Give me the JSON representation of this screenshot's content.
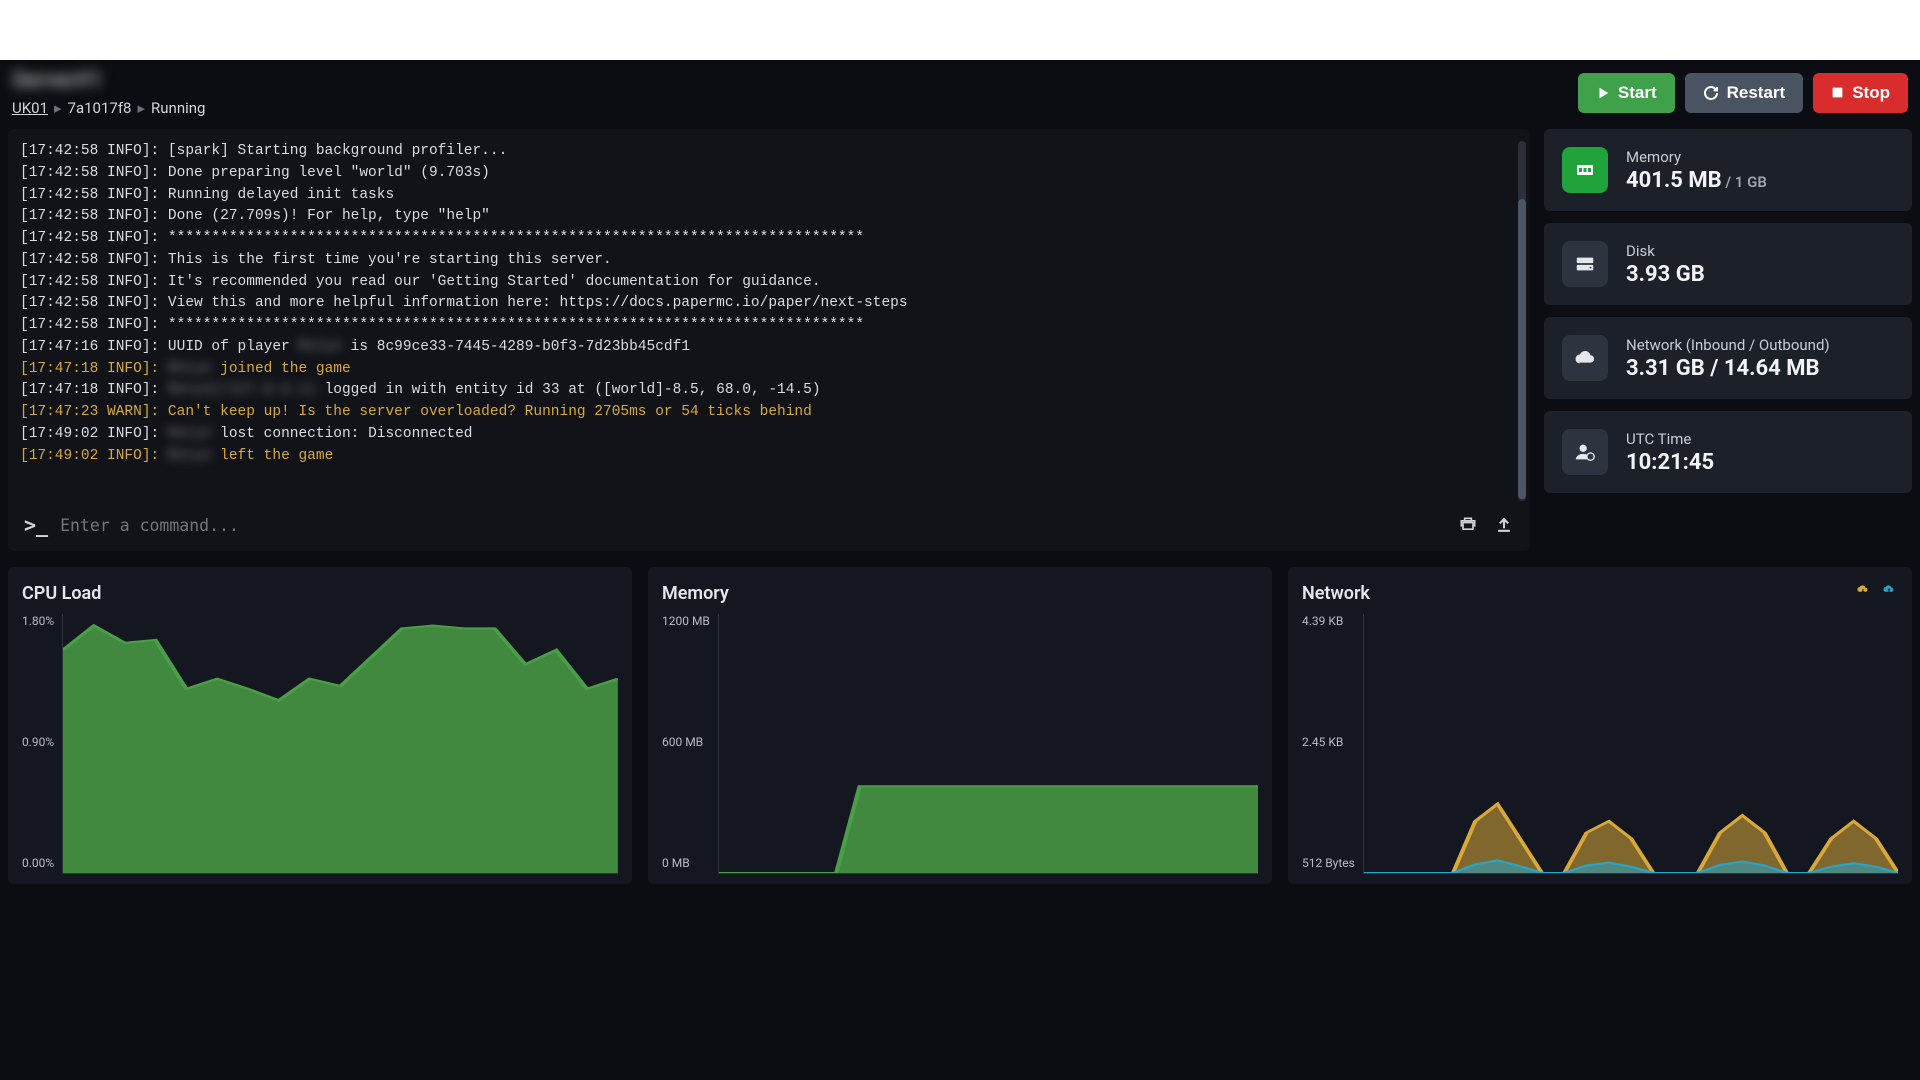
{
  "server_name_redacted": "Server#1",
  "breadcrumb": {
    "node": "UK01",
    "id": "7a1017f8",
    "status": "Running"
  },
  "buttons": {
    "start": "Start",
    "restart": "Restart",
    "stop": "Stop"
  },
  "console": {
    "placeholder": "Enter a command...",
    "lines": [
      {
        "cls": "",
        "text": "[17:42:58 INFO]: [spark] Starting background profiler..."
      },
      {
        "cls": "",
        "text": "[17:42:58 INFO]: Done preparing level \"world\" (9.703s)"
      },
      {
        "cls": "",
        "text": "[17:42:58 INFO]: Running delayed init tasks"
      },
      {
        "cls": "",
        "text": "[17:42:58 INFO]: Done (27.709s)! For help, type \"help\""
      },
      {
        "cls": "",
        "text": "[17:42:58 INFO]: ********************************************************************************"
      },
      {
        "cls": "",
        "text": "[17:42:58 INFO]: This is the first time you're starting this server."
      },
      {
        "cls": "",
        "text": "[17:42:58 INFO]: It's recommended you read our 'Getting Started' documentation for guidance."
      },
      {
        "cls": "",
        "text": "[17:42:58 INFO]: View this and more helpful information here: https://docs.papermc.io/paper/next-steps"
      },
      {
        "cls": "",
        "text": "[17:42:58 INFO]: ********************************************************************************"
      },
      {
        "cls": "",
        "text": "[17:47:16 INFO]: UUID of player ",
        "redact": "Mxtyn",
        "text2": " is 8c99ce33-7445-4289-b0f3-7d23bb45cdf1"
      },
      {
        "cls": "yellow",
        "prefix": "[17:47:18 INFO]: ",
        "redact": "Mxtyn",
        "text2": " joined the game"
      },
      {
        "cls": "",
        "prefix": "[17:47:18 INFO]: ",
        "redact": "Mxtyn[/127.0.0.1]",
        "text2": " logged in with entity id 33 at ([world]-8.5, 68.0, -14.5)"
      },
      {
        "cls": "warn",
        "text": "[17:47:23 WARN]: Can't keep up! Is the server overloaded? Running 2705ms or 54 ticks behind"
      },
      {
        "cls": "",
        "prefix": "[17:49:02 INFO]: ",
        "redact": "Mxtyn",
        "text2": " lost connection: Disconnected"
      },
      {
        "cls": "yellow",
        "prefix": "[17:49:02 INFO]: ",
        "redact": "Mxtyn",
        "text2": " left the game"
      }
    ]
  },
  "stats": {
    "memory": {
      "label": "Memory",
      "value": "401.5 MB",
      "sub": " / 1 GB"
    },
    "disk": {
      "label": "Disk",
      "value": "3.93 GB"
    },
    "network": {
      "label": "Network (Inbound / Outbound)",
      "value": "3.31 GB / 14.64 MB"
    },
    "utc": {
      "label": "UTC Time",
      "value": "10:21:45"
    }
  },
  "chart_data": [
    {
      "type": "area",
      "title": "CPU Load",
      "ylabel": "",
      "yticks": [
        "1.80%",
        "0.90%",
        "0.00%"
      ],
      "ylim": [
        0,
        1.8
      ],
      "series": [
        {
          "name": "cpu",
          "color": "#4a9e47",
          "values": [
            1.55,
            1.72,
            1.6,
            1.62,
            1.28,
            1.35,
            1.28,
            1.2,
            1.35,
            1.3,
            1.5,
            1.7,
            1.72,
            1.7,
            1.7,
            1.45,
            1.55,
            1.28,
            1.35
          ]
        }
      ]
    },
    {
      "type": "area",
      "title": "Memory",
      "ylabel": "",
      "yticks": [
        "1200 MB",
        "600 MB",
        "0 MB"
      ],
      "ylim": [
        0,
        1200
      ],
      "series": [
        {
          "name": "memory",
          "color": "#4a9e47",
          "values": [
            0,
            0,
            0,
            0,
            0,
            0,
            402,
            402,
            402,
            402,
            402,
            402,
            402,
            402,
            402,
            402,
            402,
            402,
            402,
            402,
            402,
            402,
            402,
            402
          ]
        }
      ]
    },
    {
      "type": "area",
      "title": "Network",
      "ylabel": "",
      "yticks": [
        "4.39 KB",
        "2.45 KB",
        "512 Bytes"
      ],
      "ylim": [
        0,
        4500
      ],
      "series": [
        {
          "name": "inbound",
          "color": "#d8a93a",
          "values": [
            0,
            0,
            0,
            0,
            0,
            900,
            1200,
            600,
            0,
            0,
            700,
            900,
            600,
            0,
            0,
            0,
            700,
            1000,
            700,
            0,
            0,
            600,
            900,
            600,
            0
          ]
        },
        {
          "name": "outbound",
          "color": "#2aa3c7",
          "values": [
            0,
            0,
            0,
            0,
            0,
            150,
            220,
            120,
            0,
            0,
            130,
            180,
            110,
            0,
            0,
            0,
            140,
            200,
            130,
            0,
            0,
            110,
            170,
            110,
            0
          ]
        }
      ]
    }
  ]
}
